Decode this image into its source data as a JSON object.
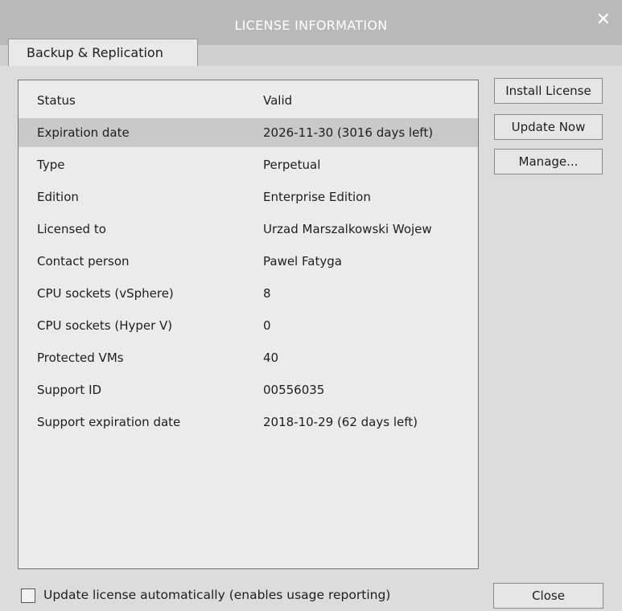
{
  "window": {
    "title": "LICENSE INFORMATION",
    "close_glyph": "✕"
  },
  "tab": {
    "label": "Backup & Replication"
  },
  "license_rows": [
    {
      "label": "Status",
      "value": "Valid"
    },
    {
      "label": "Expiration date",
      "value": "2026-11-30 (3016 days left)"
    },
    {
      "label": "Type",
      "value": "Perpetual"
    },
    {
      "label": "Edition",
      "value": "Enterprise Edition"
    },
    {
      "label": "Licensed to",
      "value": "Urzad Marszalkowski Wojew"
    },
    {
      "label": "Contact person",
      "value": "Pawel Fatyga"
    },
    {
      "label": "CPU sockets (vSphere)",
      "value": "8"
    },
    {
      "label": "CPU sockets (Hyper V)",
      "value": "0"
    },
    {
      "label": "Protected VMs",
      "value": "40"
    },
    {
      "label": "Support ID",
      "value": "00556035"
    },
    {
      "label": "Support expiration date",
      "value": "2018-10-29 (62 days left)"
    }
  ],
  "buttons": {
    "install": "Install License",
    "update": "Update Now",
    "manage": "Manage...",
    "close": "Close"
  },
  "auto_update": {
    "label": "Update license automatically (enables usage reporting)",
    "checked": false
  }
}
